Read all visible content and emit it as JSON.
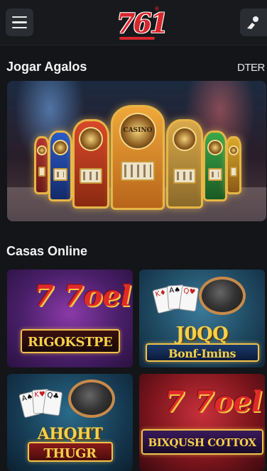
{
  "header": {
    "logo_text": "761",
    "logo_badge": "®",
    "menu_icon": "hamburger-menu-icon",
    "user_icon": "user-icon",
    "brand_color": "#d8262d"
  },
  "featured": {
    "title": "Jogar Agalos",
    "link_label": "DTER",
    "banner_marquee": "CASINO"
  },
  "casinos": {
    "title": "Casas Online",
    "games": [
      {
        "title": "RIGOKSTPE",
        "logo": "7 7oel",
        "title_color": "#f4d04a"
      },
      {
        "title_line1": "J0QQ",
        "title_line2": "Bonf-Imins",
        "title_color": "#f4d04a"
      },
      {
        "title_line1": "AHQHT",
        "title_line2": "THUGR",
        "title_color": "#f4d04a"
      },
      {
        "title": "BIXQUSH COTTOX",
        "logo": "7 7oel",
        "title_color": "#f4d04a"
      }
    ]
  }
}
